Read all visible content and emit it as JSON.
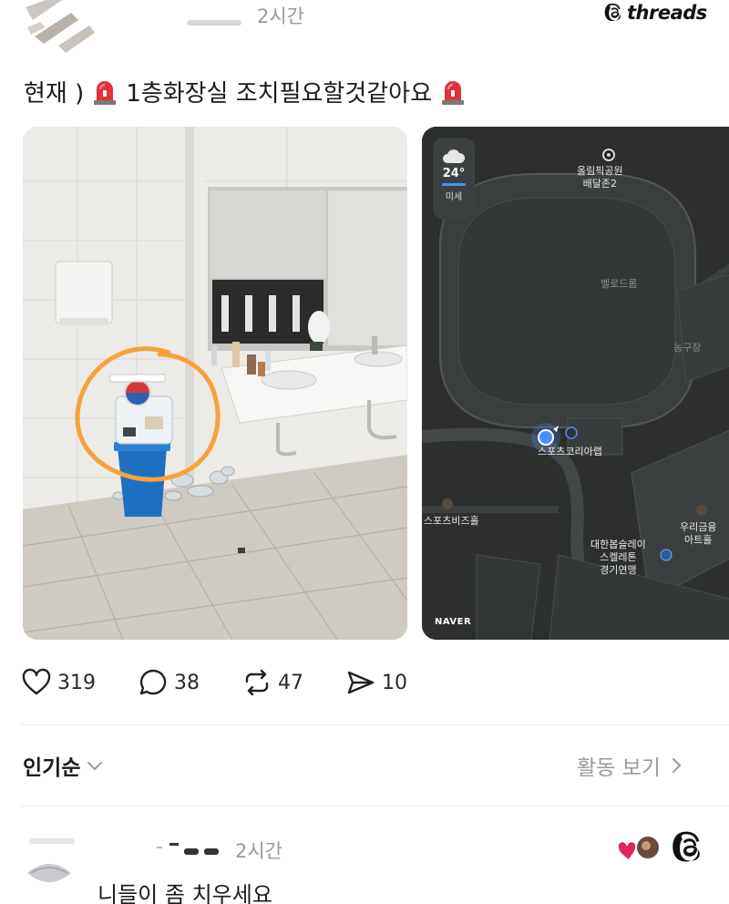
{
  "post": {
    "timestamp": "2시간",
    "brand": "threads",
    "text": "1층화장실 조치필요할것같아요",
    "text_prefix": "현재 )",
    "icons": {
      "siren": "rotating-light-icon"
    }
  },
  "map": {
    "weather_temp": "24°",
    "weather_sub": "미세",
    "labels": {
      "park": "올림픽공원\n배달존2",
      "velodrome": "벨로드롬",
      "basketball": "농구장",
      "lab": "스포츠코리아랩",
      "biz": "스포츠비즈홀",
      "woori": "우리금융\n아트홀",
      "federation": "대한봅슬레이\n스켈레톤\n경기연맹"
    },
    "brand": "NAVER"
  },
  "actions": {
    "likes": "319",
    "comments": "38",
    "reposts": "47",
    "shares": "10"
  },
  "sort": {
    "label": "인기순",
    "activity_label": "활동 보기"
  },
  "comment": {
    "username_fragment": "·",
    "timestamp": "2시간",
    "text": "니들이 좀 치우세요"
  },
  "colors": {
    "annotation_circle": "#f7a23a",
    "trash_bin": "#1e6fc2",
    "location_dot": "#4d8dff"
  }
}
